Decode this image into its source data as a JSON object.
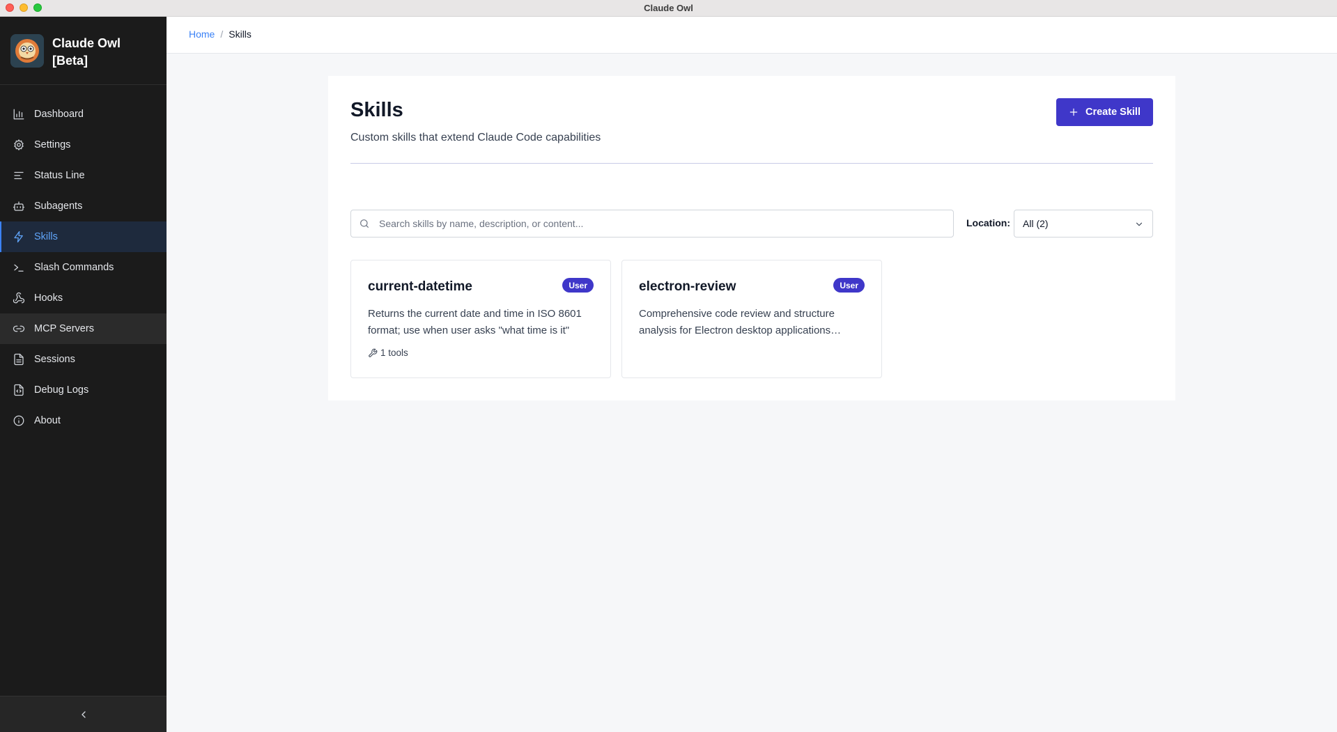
{
  "window": {
    "title": "Claude Owl"
  },
  "brand": {
    "name": "Claude Owl [Beta]"
  },
  "sidebar": {
    "items": [
      {
        "label": "Dashboard",
        "icon": "bar-chart-icon"
      },
      {
        "label": "Settings",
        "icon": "gear-icon"
      },
      {
        "label": "Status Line",
        "icon": "lines-icon"
      },
      {
        "label": "Subagents",
        "icon": "robot-icon"
      },
      {
        "label": "Skills",
        "icon": "lightning-icon",
        "active": true
      },
      {
        "label": "Slash Commands",
        "icon": "terminal-icon"
      },
      {
        "label": "Hooks",
        "icon": "webhook-icon"
      },
      {
        "label": "MCP Servers",
        "icon": "link-icon"
      },
      {
        "label": "Sessions",
        "icon": "document-icon"
      },
      {
        "label": "Debug Logs",
        "icon": "code-file-icon"
      },
      {
        "label": "About",
        "icon": "info-icon"
      }
    ]
  },
  "breadcrumb": {
    "home": "Home",
    "separator": "/",
    "current": "Skills"
  },
  "page": {
    "title": "Skills",
    "subtitle": "Custom skills that extend Claude Code capabilities",
    "create_label": "Create Skill"
  },
  "search": {
    "placeholder": "Search skills by name, description, or content...",
    "value": ""
  },
  "location": {
    "label": "Location:",
    "selected": "All (2)"
  },
  "skills": [
    {
      "name": "current-datetime",
      "badge": "User",
      "description": "Returns the current date and time in ISO 8601 format; use when user asks \"what time is it\"",
      "tools": "1 tools"
    },
    {
      "name": "electron-review",
      "badge": "User",
      "description": "Comprehensive code review and structure analysis for Electron desktop applications including security checks",
      "tools": ""
    }
  ],
  "colors": {
    "accent": "#3f37c9",
    "sidebar_bg": "#1b1b1b",
    "active_link": "#60a5fa"
  }
}
